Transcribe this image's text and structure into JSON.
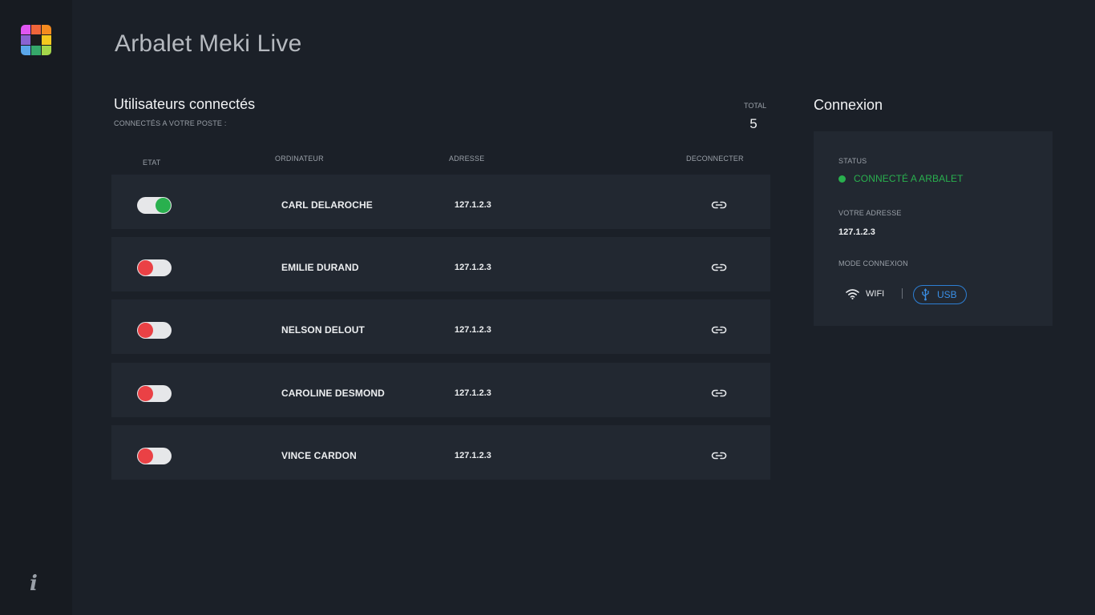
{
  "colors": {
    "accent_green": "#29b04e",
    "accent_red": "#ea4145",
    "accent_blue": "#3a8fe6"
  },
  "logo_tiles": [
    "#e056f2",
    "#f0653a",
    "#f58b1f",
    "#8a63d2",
    "#1d1d1d",
    "#f5c91e",
    "#5aa7ea",
    "#36a86a",
    "#a4d64a"
  ],
  "sidebar": {
    "logo_icon": "app-logo-grid",
    "info_glyph": "i"
  },
  "header": {
    "title": "Arbalet Meki Live"
  },
  "users_section": {
    "title": "Utilisateurs connectés",
    "subtitle": "CONNECTÉS A VOTRE POSTE  :",
    "total_label": "TOTAL",
    "total_value": "5",
    "columns": {
      "state": "ETAT",
      "computer": "ORDINATEUR",
      "address": "ADRESSE",
      "disconnect": "DECONNECTER"
    },
    "rows": [
      {
        "state": "on",
        "name": "CARL DELAROCHE",
        "address": "127.1.2.3",
        "action_icon": "link-icon"
      },
      {
        "state": "off",
        "name": "EMILIE DURAND",
        "address": "127.1.2.3",
        "action_icon": "link-icon"
      },
      {
        "state": "off",
        "name": "NELSON DELOUT",
        "address": "127.1.2.3",
        "action_icon": "link-icon"
      },
      {
        "state": "off",
        "name": "CAROLINE DESMOND",
        "address": "127.1.2.3",
        "action_icon": "link-icon"
      },
      {
        "state": "off",
        "name": "VINCE CARDON",
        "address": "127.1.2.3",
        "action_icon": "link-icon"
      }
    ]
  },
  "connection": {
    "title": "Connexion",
    "status_label": "STATUS",
    "status_value": "CONNECTÉ A ARBALET",
    "address_label": "VOTRE ADRESSE",
    "address_value": "127.1.2.3",
    "mode_label": "MODE CONNEXION",
    "wifi_label": "WIFI",
    "usb_label": "USB",
    "selected_mode": "USB"
  }
}
